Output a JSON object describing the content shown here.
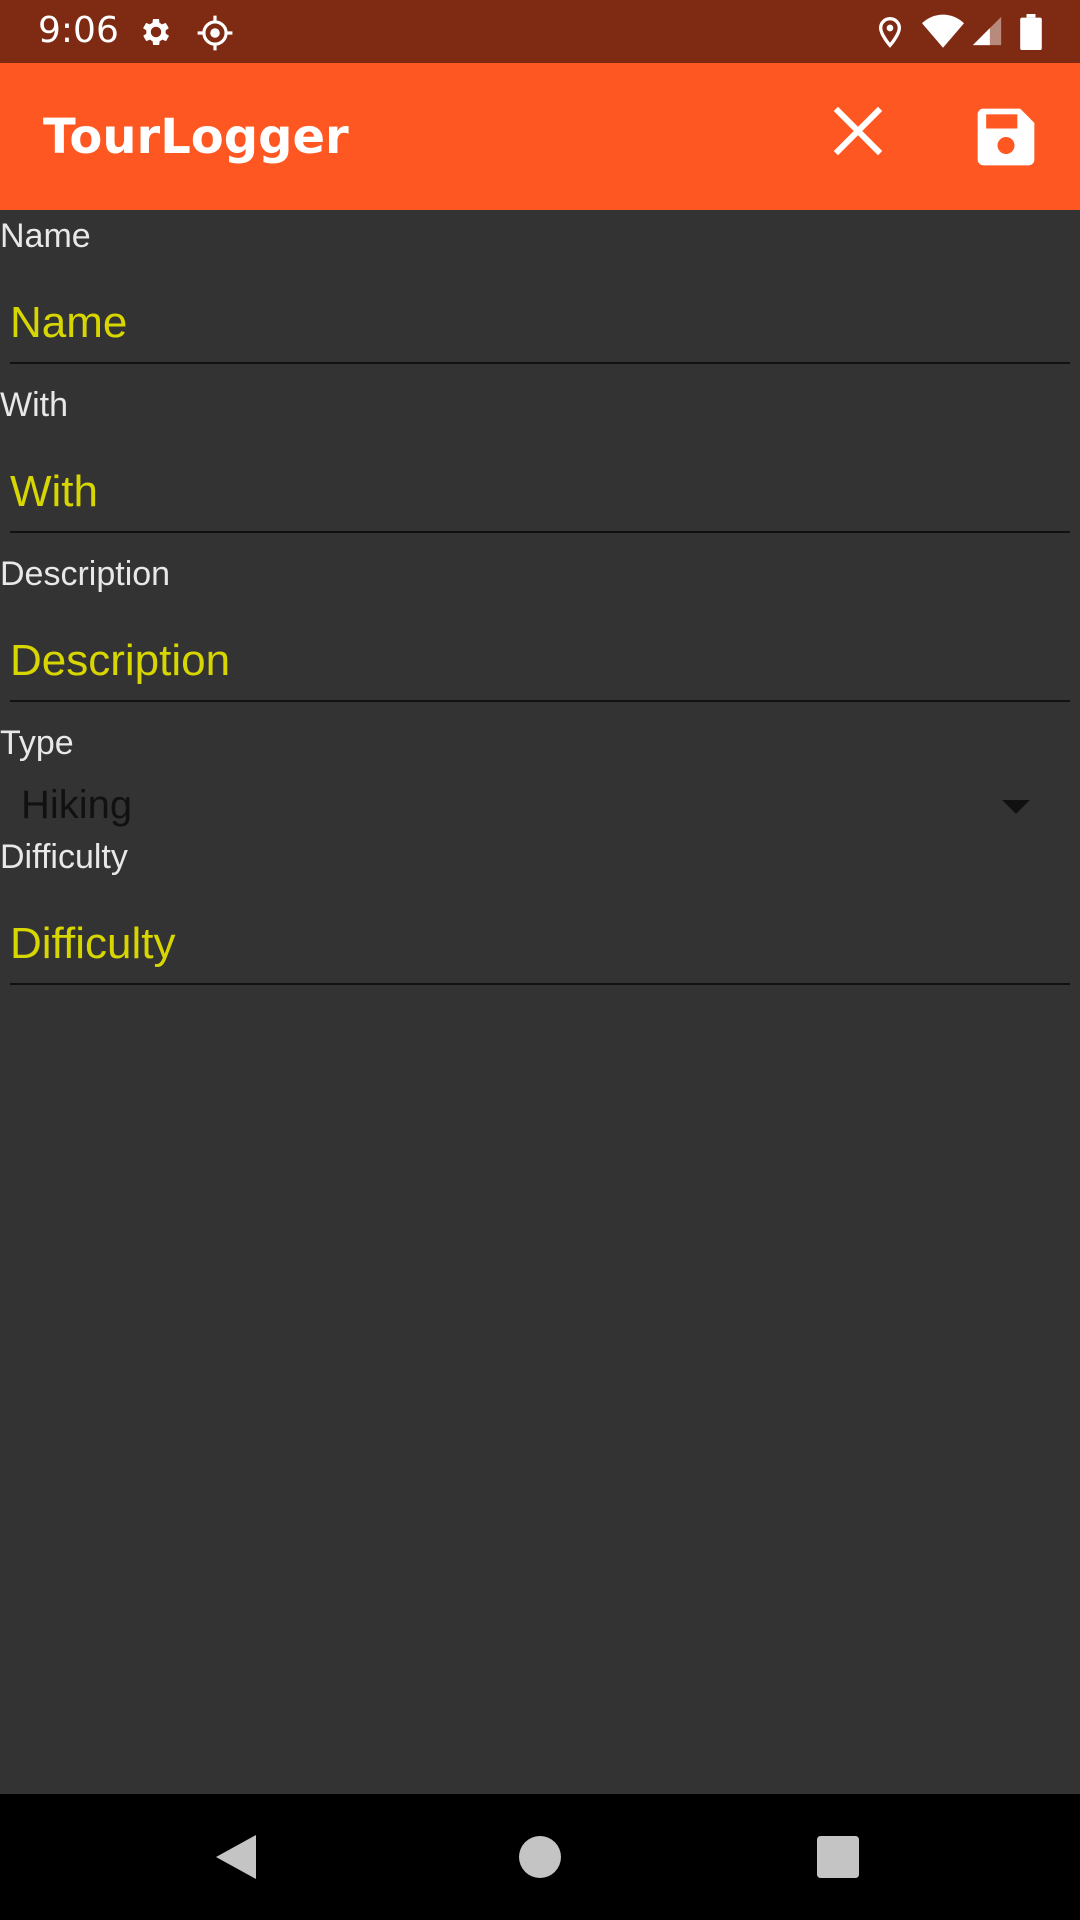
{
  "status_bar": {
    "time": "9:06",
    "icons": [
      "settings-icon",
      "location-target-icon",
      "location-pin-icon",
      "wifi-icon",
      "cell-signal-icon",
      "battery-icon"
    ]
  },
  "app_bar": {
    "title": "TourLogger",
    "actions": [
      "close-icon",
      "save-icon"
    ]
  },
  "form": {
    "name": {
      "label": "Name",
      "placeholder": "Name",
      "value": ""
    },
    "with": {
      "label": "With",
      "placeholder": "With",
      "value": ""
    },
    "description": {
      "label": "Description",
      "placeholder": "Description",
      "value": ""
    },
    "type": {
      "label": "Type",
      "selected": "Hiking"
    },
    "difficulty": {
      "label": "Difficulty",
      "placeholder": "Difficulty",
      "value": ""
    }
  },
  "nav_bar": {
    "buttons": [
      "back-icon",
      "home-icon",
      "recents-icon"
    ]
  },
  "colors": {
    "status_bar": "#7f2a12",
    "app_bar": "#ff5722",
    "background": "#333333",
    "input_text": "#d8d600",
    "label_text": "#e8e8e8",
    "nav_bar": "#000000"
  }
}
